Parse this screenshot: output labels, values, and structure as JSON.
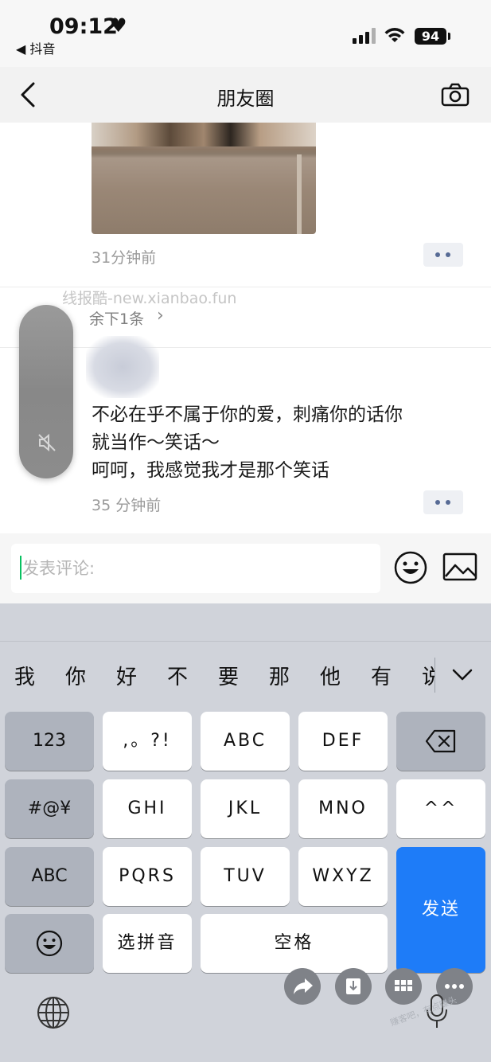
{
  "status_bar": {
    "time": "09:12",
    "back_app": "◀ 抖音",
    "battery": "94"
  },
  "nav": {
    "title": "朋友圈"
  },
  "feed": {
    "first_post_time": "31分钟前",
    "watermark": "线报酷-new.xianbao.fun",
    "remaining": "余下1条",
    "post_text_lines": [
      "不必在乎不属于你的爱，刺痛你的话你",
      "就当作～笑话～",
      "呵呵，我感觉我才是那个笑话"
    ],
    "second_post_time": "35 分钟前"
  },
  "comment": {
    "placeholder": "发表评论:"
  },
  "keyboard": {
    "candidates": [
      "我",
      "你",
      "好",
      "不",
      "要",
      "那",
      "他",
      "有",
      "说"
    ],
    "rows": {
      "r1": [
        "123",
        ",。?!",
        "ABC",
        "DEF"
      ],
      "r2": [
        "#@¥",
        "GHI",
        "JKL",
        "MNO",
        "^^"
      ],
      "r3": [
        "ABC",
        "PQRS",
        "TUV",
        "WXYZ"
      ],
      "r4_select": "选拼音",
      "r4_space": "空格"
    },
    "send": "发送"
  },
  "corner_watermark": "赚客吧，有点赚头"
}
